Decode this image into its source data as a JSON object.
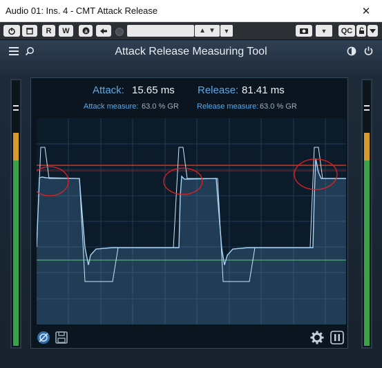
{
  "window": {
    "title": "Audio 01: Ins. 4 - CMT Attack Release",
    "close_glyph": "✕"
  },
  "host_toolbar": {
    "read_label": "R",
    "write_label": "W",
    "qc_label": "QC"
  },
  "plugin": {
    "title": "Attack Release Measuring Tool",
    "attack_label": "Attack:",
    "attack_value": "15.65 ms",
    "release_label": "Release:",
    "release_value": "81.41 ms",
    "attack_measure_label": "Attack measure:",
    "attack_measure_value": "63.0 % GR",
    "release_measure_label": "Release measure:",
    "release_measure_value": "63.0 % GR"
  },
  "colors": {
    "accent": "#5aa9e6",
    "trace": "#a8d4f5",
    "threshold_red": "#c0392b",
    "threshold_green": "#3fa34d",
    "annotation_circle": "#e02020"
  },
  "icons": [
    "hamburger-icon",
    "search-icon",
    "contrast-icon",
    "power-icon",
    "bypass-icon",
    "save-icon",
    "gear-icon",
    "pause-icon"
  ]
}
